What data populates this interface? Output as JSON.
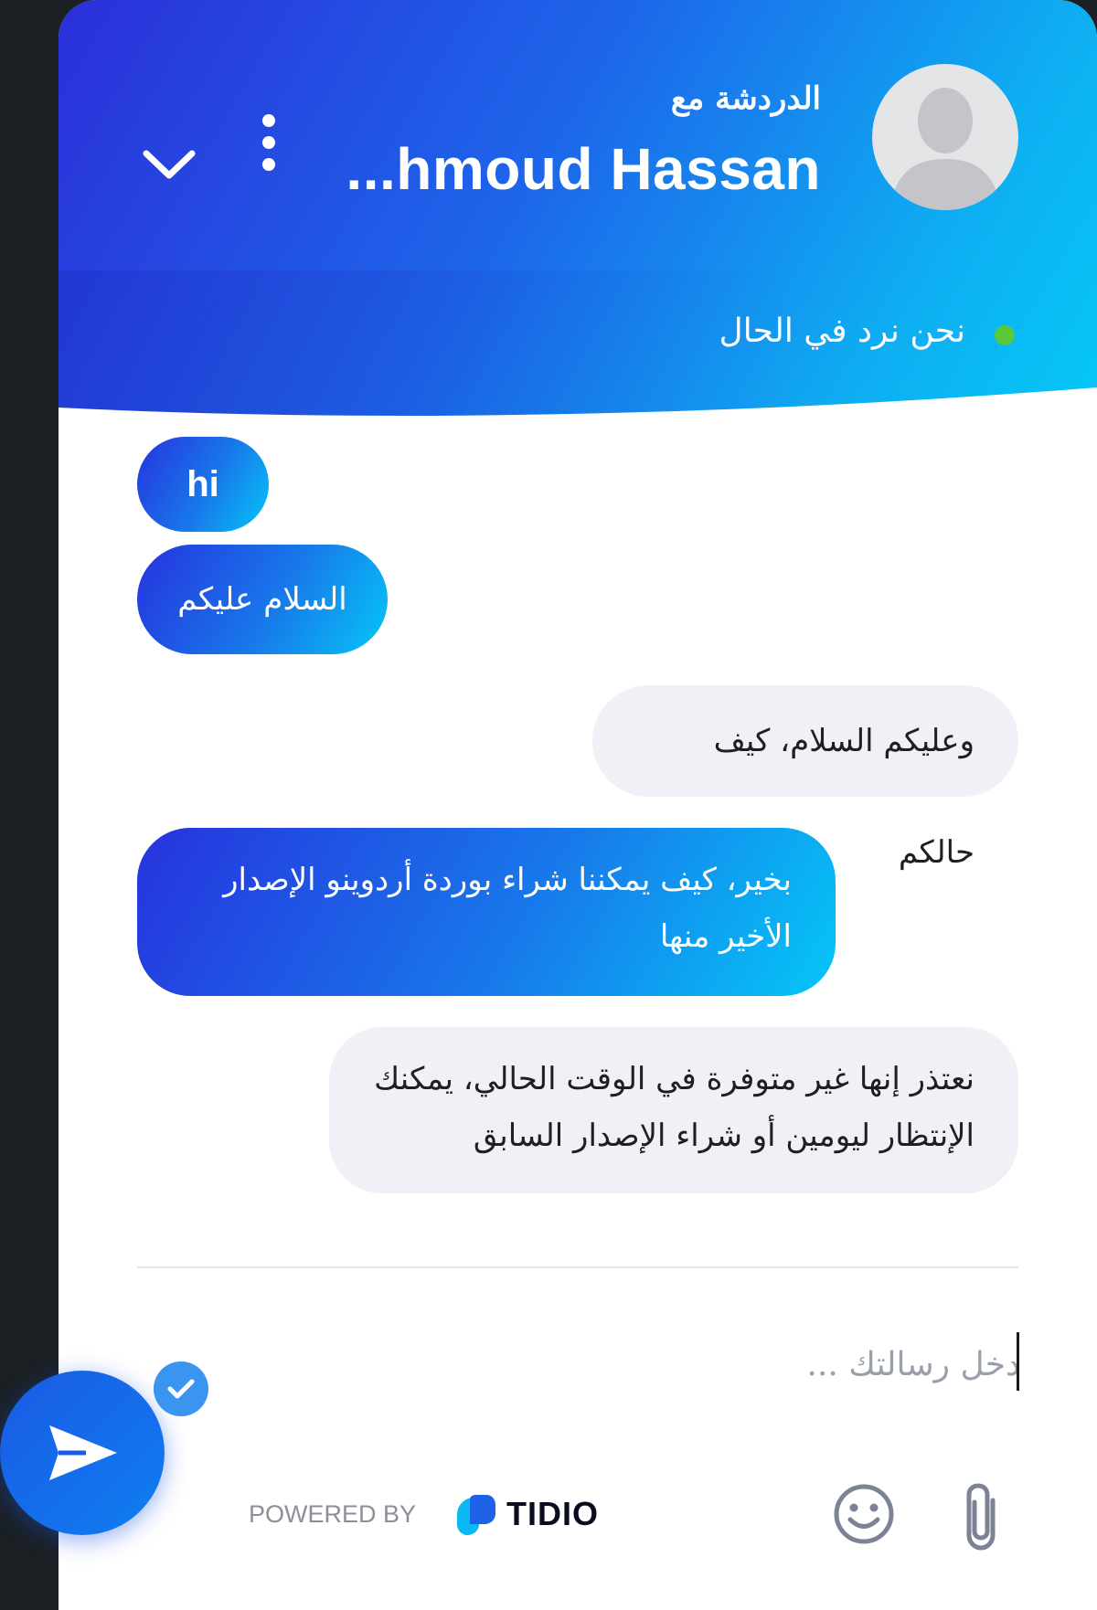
{
  "header": {
    "subtitle": "الدردشة مع",
    "agent_name": "...hmoud Hassan",
    "status_text": "نحن نرد في الحال"
  },
  "messages": [
    {
      "sender": "visitor",
      "text": "hi"
    },
    {
      "sender": "visitor",
      "text": "السلام عليكم"
    },
    {
      "sender": "operator",
      "text": "وعليكم السلام، كيف حالكم"
    },
    {
      "sender": "visitor",
      "line1": "بخير، كيف يمكننا شراء بوردة أردوينو الإصدار",
      "line2": "الأخير منها"
    },
    {
      "sender": "operator",
      "line1": "نعتذر إنها غير متوفرة في الوقت الحالي، يمكنك",
      "line2": "الإنتظار ليومين أو شراء الإصدار السابق"
    }
  ],
  "composer": {
    "placeholder": "دخل رسالتك ...",
    "value": ""
  },
  "footer": {
    "powered_by": "POWERED BY",
    "brand": "TIDIO"
  },
  "icons": {
    "minimize": "chevron-down-icon",
    "menu": "vertical-dots-icon",
    "avatar": "user-silhouette-icon",
    "send": "paper-plane-icon",
    "read": "check-icon",
    "emoji": "smiley-icon",
    "attach": "paperclip-icon"
  },
  "colors": {
    "header_gradient_start": "#2b2fd9",
    "header_gradient_end": "#05c8f7",
    "online": "#59c83b",
    "operator_bubble": "#f0f1f6",
    "send_button": "#1a5ae6"
  }
}
